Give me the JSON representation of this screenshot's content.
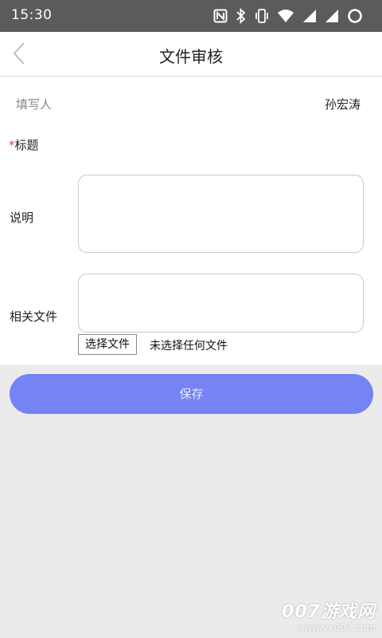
{
  "status_bar": {
    "time": "15:30",
    "icons": [
      "nfc-icon",
      "bluetooth-icon",
      "vibrate-icon",
      "wifi-icon",
      "signal-icon",
      "signal-icon-2",
      "loading-circle-icon"
    ]
  },
  "header": {
    "title": "文件审核",
    "back_icon": "chevron-left-icon"
  },
  "form": {
    "filler_label": "填写人",
    "filler_value": "孙宏涛",
    "title_required_mark": "*",
    "title_label": "标题",
    "description_label": "说明",
    "description_value": "",
    "related_files_label": "相关文件",
    "choose_file_button": "选择文件",
    "no_file_text": "未选择任何文件"
  },
  "save_button": {
    "label": "保存"
  },
  "watermark": {
    "main": "007游戏网",
    "sub": "www.yx007.com"
  },
  "colors": {
    "status_bar_bg": "#5b5b5b",
    "accent_button": "#7583f4",
    "required_star": "#e0483e",
    "page_background": "#ebebeb"
  }
}
